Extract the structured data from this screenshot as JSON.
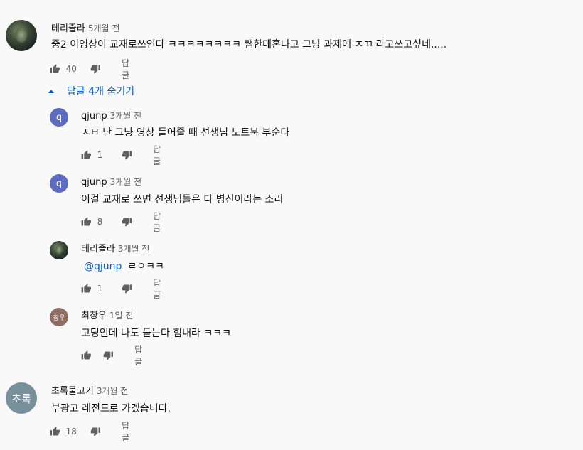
{
  "comments": [
    {
      "author": "테리즐라",
      "time": "5개월 전",
      "text": "중2 이영상이 교재로쓰인다 ㅋㅋㅋㅋㅋㅋㅋㅋ 쌤한테혼나고 그냥 과제에 ㅈㄲ 라고쓰고싶네.....",
      "likes": "40",
      "reply_label": "답글",
      "avatar_icon": "mech-warrior-avatar-image",
      "toggle_replies": "답글 4개 숨기기",
      "replies": [
        {
          "author": "qjunp",
          "time": "3개월 전",
          "avatar_letter": "q",
          "text": "ㅅㅂ 난 그냥 영상 틀어줄 때 선생님 노트북 부순다",
          "likes": "1",
          "reply_label": "답글"
        },
        {
          "author": "qjunp",
          "time": "3개월 전",
          "avatar_letter": "q",
          "text": "이걸 교재로 쓰면 선생님들은 다 병신이라는 소리",
          "likes": "8",
          "reply_label": "답글"
        },
        {
          "author": "테리즐라",
          "time": "3개월 전",
          "mention": "@qjunp",
          "text": "ㄹㅇㅋㅋ",
          "likes": "1",
          "reply_label": "답글"
        },
        {
          "author": "최창우",
          "time": "1일 전",
          "avatar_letter": "창우",
          "text": "고딩인데 나도 듣는다 힘내라 ㅋㅋㅋ",
          "likes": "",
          "reply_label": "답글"
        }
      ]
    },
    {
      "author": "초록물고기",
      "time": "3개월 전",
      "avatar_letter": "초록",
      "text": "부광고 레전드로 가겠습니다.",
      "likes": "18",
      "reply_label": "답글"
    }
  ],
  "colors": {
    "link": "#065fd4",
    "meta": "#606060",
    "text": "#0f0f0f",
    "bg": "#f9f9f9",
    "q_avatar": "#5c6bc0",
    "cw_avatar": "#8d6e63",
    "cr_avatar": "#78909c"
  },
  "icons": {
    "like": "thumb-up-icon",
    "dislike": "thumb-down-icon",
    "toggle": "caret-up-icon"
  }
}
